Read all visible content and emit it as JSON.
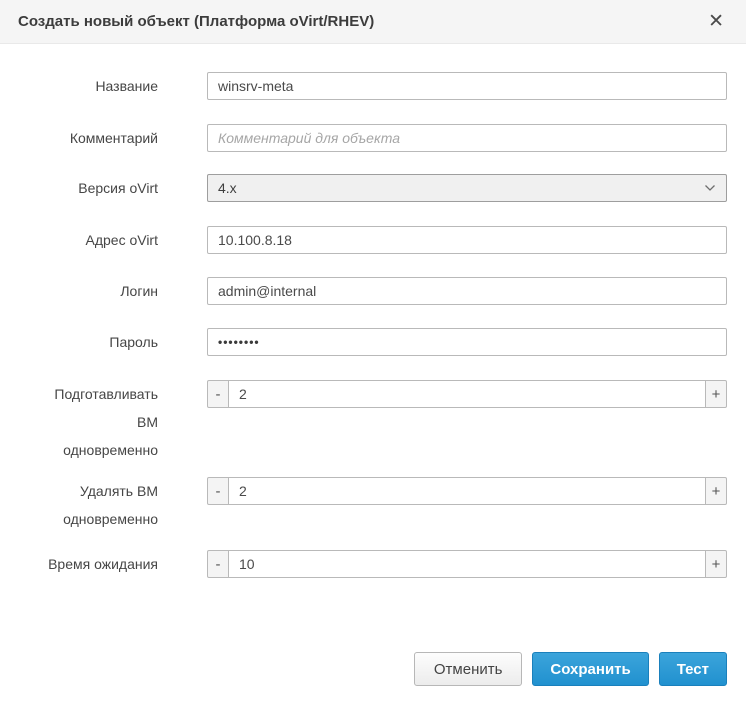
{
  "dialog": {
    "title": "Создать новый объект (Платформа oVirt/RHEV)",
    "close_glyph": "✕"
  },
  "fields": {
    "name": {
      "label": "Название",
      "value": "winsrv-meta"
    },
    "comment": {
      "label": "Комментарий",
      "value": "",
      "placeholder": "Комментарий для объекта"
    },
    "version": {
      "label": "Версия oVirt",
      "value": "4.x"
    },
    "address": {
      "label": "Адрес oVirt",
      "value": "10.100.8.18"
    },
    "login": {
      "label": "Логин",
      "value": "admin@internal"
    },
    "password": {
      "label": "Пароль",
      "value": "••••••••"
    },
    "provision_concurrency": {
      "label": "Подготавливать\nВМ\nодновременно",
      "value": "2"
    },
    "delete_concurrency": {
      "label": "Удалять ВМ\nодновременно",
      "value": "2"
    },
    "timeout": {
      "label": "Время ожидания",
      "value": "10"
    }
  },
  "stepper": {
    "minus_glyph": "-",
    "plus_glyph": "+"
  },
  "footer": {
    "cancel_label": "Отменить",
    "save_label": "Сохранить",
    "test_label": "Тест"
  },
  "colors": {
    "primary_button": "#2b97d3",
    "primary_button_border": "#1a80bc",
    "header_bg": "#f5f5f5"
  }
}
